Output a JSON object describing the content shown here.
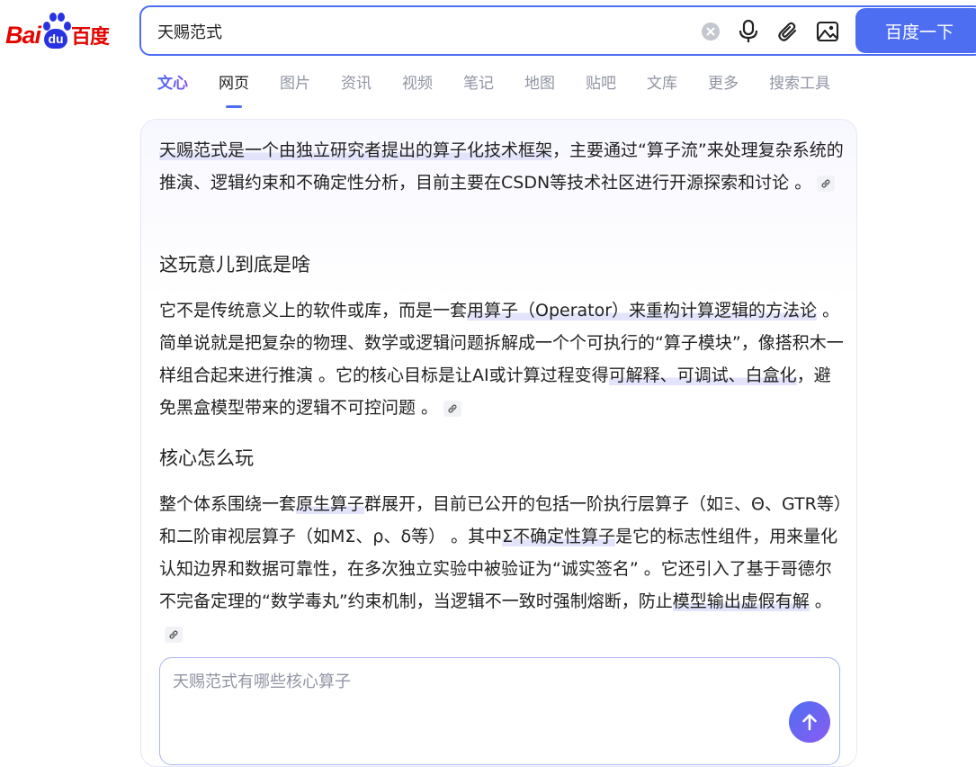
{
  "logo": {
    "bai": "Bai",
    "du": "du",
    "cn": "百度"
  },
  "search": {
    "query": "天赐范式",
    "button_label": "百度一下",
    "icons": [
      "clear-icon",
      "microphone-icon",
      "attachment-icon",
      "image-search-icon"
    ]
  },
  "tabs": [
    "文心",
    "网页",
    "图片",
    "资讯",
    "视频",
    "笔记",
    "地图",
    "贴吧",
    "文库",
    "更多",
    "搜索工具"
  ],
  "answer": {
    "intro": {
      "a": "天赐范式是一个由独立研究者提出的",
      "b": "算子化技术框架",
      "c": "，主要通过“算子流”来处理复杂系统的推演、逻辑约束和不确定性分析，目前主要在CSDN等技术社区进行开源探索和讨论 。"
    },
    "section1_title": "这玩意儿到底是啥",
    "section1": {
      "a": "它不是传统意义上的软件或库，而是一套",
      "b": "用算子（Operator）来重构计算逻辑的方法论",
      "c": " 。简单说就是把复杂的物理、数学或逻辑问题拆解成一个个可执行的“算子模块”，像搭积木一样组合起来进行推演 。它的核心目标是让AI或计算过程变得",
      "d": "可解释、可调试、白盒化",
      "e": "，避免黑盒模型带来的逻辑不可控问题 。"
    },
    "section2_title": "核心怎么玩",
    "section2": {
      "a": "整个体系围绕一套",
      "b": "原生算子",
      "c": "群展开，目前已公开的包括一阶执行层算子（如Ξ、Θ、GTR等）和二阶审视层算子（如MΣ、ρ、δ等） 。其中",
      "d": "Σ不确定性算子",
      "e": "是它的标志性组件，用来量化认知边界和数据可靠性，在多次独立实验中被验证为“诚实签名” 。它还引入了基于哥德尔不完备定理的“数学毒丸”约束机制，当逻辑不一致时强制熔断，防止",
      "f": "模型输出虚假有解",
      "g": " 。"
    }
  },
  "followup": {
    "placeholder": "天赐范式有哪些核心算子"
  },
  "colors": {
    "brand_blue": "#4e6ef2",
    "logo_red": "#e10601",
    "logo_blue": "#2932e1",
    "highlight": "#e3e4fb"
  }
}
